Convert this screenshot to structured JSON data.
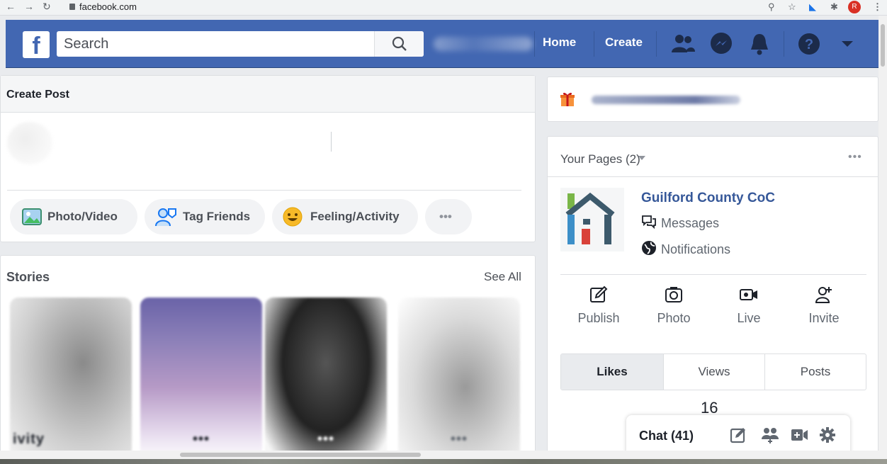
{
  "browser": {
    "url": "facebook.com",
    "profile_initial": "R"
  },
  "topbar": {
    "logo": "f",
    "search_placeholder": "Search",
    "nav_home": "Home",
    "nav_create": "Create",
    "help_glyph": "?"
  },
  "create_post": {
    "title": "Create Post",
    "actions": [
      "Photo/Video",
      "Tag Friends",
      "Feeling/Activity",
      "•••"
    ]
  },
  "stories": {
    "title": "Stories",
    "see_all": "See All",
    "items": [
      {
        "dots": "ivity"
      },
      {
        "dots": "•••"
      },
      {
        "dots": "•••"
      },
      {
        "dots": "•••"
      }
    ]
  },
  "your_pages": {
    "title": "Your Pages (2)",
    "more": "•••",
    "page_name": "Guilford County CoC",
    "messages": "Messages",
    "notifications": "Notifications",
    "actions": [
      "Publish",
      "Photo",
      "Live",
      "Invite"
    ],
    "tabs": [
      "Likes",
      "Views",
      "Posts"
    ],
    "likes_count": "16"
  },
  "chat": {
    "label": "Chat (41)"
  },
  "colors": {
    "fb_blue": "#4267b2",
    "link_blue": "#365899",
    "page_bg": "#e9ebee"
  }
}
